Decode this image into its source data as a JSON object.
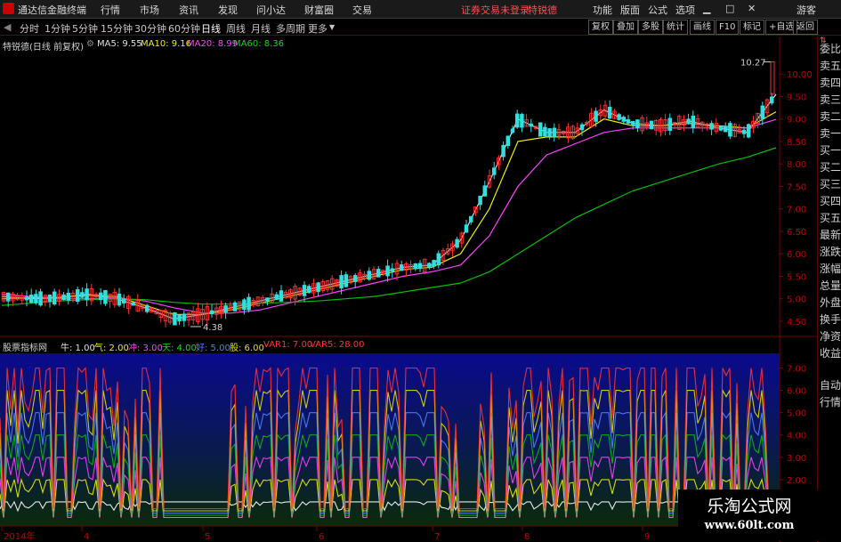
{
  "menubar": {
    "app_title": "通达信金融终端",
    "items": [
      "行情",
      "市场",
      "资讯",
      "发现",
      "问小达",
      "财富圈",
      "交易"
    ],
    "notice": "证券交易未登录",
    "stock_link": "特锐德",
    "right_items": [
      "功能",
      "版面",
      "公式",
      "选项"
    ],
    "guest": "游客"
  },
  "periods": [
    "分时",
    "1分钟",
    "5分钟",
    "15分钟",
    "30分钟",
    "60分钟",
    "日线",
    "周线",
    "月线",
    "多周期",
    "更多"
  ],
  "active_period": "日线",
  "toolbar": [
    "复权",
    "叠加",
    "多股",
    "统计",
    "画线",
    "F10",
    "标记",
    "+自选",
    "返回"
  ],
  "main_chart": {
    "title": "特锐德(日线 前复权)",
    "ma_labels": [
      {
        "text": "MA5: 9.55",
        "color": "#e0e0e0"
      },
      {
        "text": "MA10: 9.16",
        "color": "#f0f000"
      },
      {
        "text": "MA20: 8.99",
        "color": "#ff40ff"
      },
      {
        "text": "MA60: 8.36",
        "color": "#00e000"
      }
    ],
    "price_ticks": [
      "10.00",
      "9.50",
      "9.00",
      "8.50",
      "8.00",
      "7.50",
      "7.00",
      "6.50",
      "6.00",
      "5.50",
      "5.00",
      "4.50"
    ],
    "high_label": "10.27",
    "low_label": "4.38"
  },
  "indicator_chart": {
    "title": "股票指标网",
    "labels": [
      {
        "text": "牛: 1.00",
        "color": "#e0e0e0"
      },
      {
        "text": "气: 2.00",
        "color": "#f0f000"
      },
      {
        "text": "冲: 3.00",
        "color": "#ff40ff"
      },
      {
        "text": "天: 4.00",
        "color": "#00e000"
      },
      {
        "text": "好: 5.00",
        "color": "#5080ff"
      },
      {
        "text": "股: 6.00",
        "color": "#e0e000"
      },
      {
        "text": "VAR1: 7.00",
        "color": "#ff3030"
      },
      {
        "text": "VAR5: 28.00",
        "color": "#ff3030"
      }
    ],
    "ticks": [
      "7.00",
      "6.00",
      "5.00",
      "4.00",
      "3.00",
      "2.00"
    ]
  },
  "time_axis": [
    "2014年",
    "4",
    "5",
    "6",
    "7",
    "8",
    "9"
  ],
  "right_panel": [
    "委比",
    "卖五",
    "卖四",
    "卖三",
    "卖二",
    "卖一",
    "买一",
    "买二",
    "买三",
    "买四",
    "买五",
    "最新",
    "涨跌",
    "涨幅",
    "总量",
    "外盘",
    "换手",
    "净资",
    "收益",
    "自动",
    "行情"
  ],
  "watermark": {
    "cn": "乐淘公式网",
    "url": "www.60lt.com"
  },
  "chart_data": {
    "type": "candlestick",
    "title": "特锐德(日线 前复权)",
    "ylim": [
      4.3,
      10.4
    ],
    "x": [
      "2014年",
      "4",
      "5",
      "6",
      "7",
      "8",
      "9"
    ],
    "series": [
      {
        "name": "MA5",
        "values": [
          5.05,
          5.0,
          5.02,
          5.1,
          5.0,
          4.8,
          4.55,
          4.65,
          4.8,
          4.95,
          5.1,
          5.25,
          5.4,
          5.55,
          5.7,
          5.75,
          6.3,
          7.6,
          9.0,
          8.7,
          8.7,
          9.2,
          8.9,
          8.85,
          8.95,
          8.8,
          8.7,
          9.55
        ]
      },
      {
        "name": "MA10",
        "values": [
          5.0,
          5.02,
          5.03,
          5.08,
          5.05,
          4.85,
          4.65,
          4.65,
          4.75,
          4.9,
          5.05,
          5.2,
          5.35,
          5.5,
          5.65,
          5.7,
          6.0,
          7.0,
          8.5,
          8.6,
          8.6,
          9.0,
          8.85,
          8.85,
          8.9,
          8.85,
          8.8,
          9.16
        ]
      },
      {
        "name": "MA20",
        "values": [
          5.1,
          5.05,
          5.0,
          5.0,
          5.02,
          4.95,
          4.8,
          4.68,
          4.68,
          4.75,
          4.9,
          5.05,
          5.2,
          5.35,
          5.5,
          5.6,
          5.75,
          6.4,
          7.5,
          8.2,
          8.45,
          8.7,
          8.8,
          8.8,
          8.8,
          8.8,
          8.8,
          8.99
        ]
      },
      {
        "name": "MA60",
        "values": [
          4.85,
          4.9,
          4.95,
          4.98,
          5.0,
          4.98,
          4.92,
          4.88,
          4.88,
          4.9,
          4.92,
          4.95,
          5.0,
          5.05,
          5.15,
          5.25,
          5.35,
          5.6,
          6.0,
          6.4,
          6.8,
          7.1,
          7.4,
          7.6,
          7.8,
          8.0,
          8.15,
          8.36
        ]
      }
    ],
    "high": 10.27,
    "low": 4.38,
    "indicator_series": [
      {
        "name": "牛",
        "value": 1.0
      },
      {
        "name": "气",
        "value": 2.0
      },
      {
        "name": "冲",
        "value": 3.0
      },
      {
        "name": "天",
        "value": 4.0
      },
      {
        "name": "好",
        "value": 5.0
      },
      {
        "name": "股",
        "value": 6.0
      },
      {
        "name": "VAR1",
        "value": 7.0
      },
      {
        "name": "VAR5",
        "value": 28.0
      }
    ],
    "indicator_ylim": [
      0,
      7.5
    ]
  }
}
